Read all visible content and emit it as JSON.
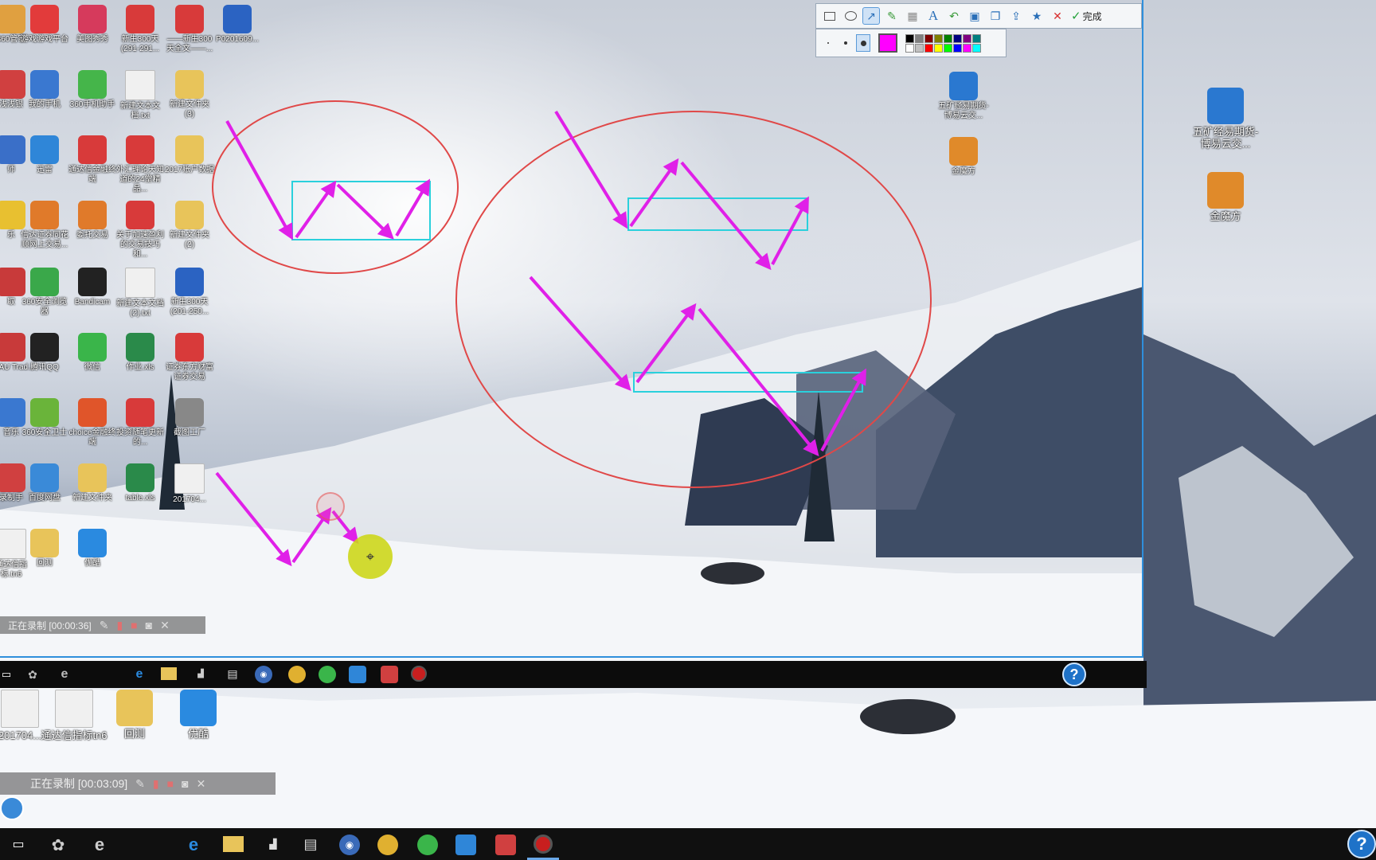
{
  "colors": {
    "annotation_arrow": "#e020e8",
    "annotation_rect": "#2ad0dc",
    "annotation_ellipse": "#e04848",
    "selection_border": "#2f8fdc",
    "current_color": "#ff00ff"
  },
  "desktop_icons": [
    {
      "label": "360管家",
      "icon": "app-icon",
      "color": "#e0a040"
    },
    {
      "label": "游戏游戏平台",
      "icon": "game-center-icon",
      "color": "#e23b3b"
    },
    {
      "label": "美图秀秀",
      "icon": "meitu-icon",
      "color": "#d63a5c"
    },
    {
      "label": "新生300天 (291-291...",
      "icon": "pdf-icon",
      "color": "#d83a3a"
    },
    {
      "label": "——新生300天全文——...",
      "icon": "pdf-icon",
      "color": "#d83a3a"
    },
    {
      "label": "P0201609...",
      "icon": "word-doc-icon",
      "color": "#2b63c2"
    },
    {
      "label": "浅浅银",
      "icon": "app-icon",
      "color": "#d04040"
    },
    {
      "label": "我的手机",
      "icon": "phone-icon",
      "color": "#3a78d0"
    },
    {
      "label": "360手机助手",
      "icon": "phone-assistant-icon",
      "color": "#45b54a"
    },
    {
      "label": "新建文本文档.txt",
      "icon": "text-file-icon",
      "color": "#f0f0f0"
    },
    {
      "label": "新建文件夹 (3)",
      "icon": "folder-icon",
      "color": "#e8c45a"
    },
    {
      "label": "师",
      "icon": "app-icon",
      "color": "#3a6fc8"
    },
    {
      "label": "迅雷",
      "icon": "thunder-icon",
      "color": "#2f86d8"
    },
    {
      "label": "通达信金融终端",
      "icon": "tdx-icon",
      "color": "#d83a3a"
    },
    {
      "label": "外汇理论天知道的24堂精品...",
      "icon": "pdf-icon",
      "color": "#d83a3a"
    },
    {
      "label": "2017账户数据",
      "icon": "folder-icon",
      "color": "#e8c45a"
    },
    {
      "label": "乐",
      "icon": "app-icon",
      "color": "#e8c030"
    },
    {
      "label": "信达证券同花顺网上交易...",
      "icon": "house-icon",
      "color": "#e07a2a"
    },
    {
      "label": "委托交易",
      "icon": "house-icon",
      "color": "#e07a2a"
    },
    {
      "label": "关于加速盈利的交易技巧和...",
      "icon": "pdf-icon",
      "color": "#d83a3a"
    },
    {
      "label": "新建文件夹 (2)",
      "icon": "folder-icon",
      "color": "#e8c45a"
    },
    {
      "label": "取",
      "icon": "app-icon",
      "color": "#c83a3a"
    },
    {
      "label": "360安全浏览器",
      "icon": "browser-360-icon",
      "color": "#3aa84a"
    },
    {
      "label": "Bandicam",
      "icon": "bandicam-icon",
      "color": "#222222"
    },
    {
      "label": "新建文本文档 (2).txt",
      "icon": "text-file-icon",
      "color": "#f0f0f0"
    },
    {
      "label": "新生300天 (201-250...",
      "icon": "word-doc-icon",
      "color": "#2b63c2"
    },
    {
      "label": "aA AU Trad...",
      "icon": "app-icon",
      "color": "#c83a3a"
    },
    {
      "label": "腾讯QQ",
      "icon": "qq-icon",
      "color": "#222222"
    },
    {
      "label": "微信",
      "icon": "wechat-icon",
      "color": "#3ab54a"
    },
    {
      "label": "作业.xls",
      "icon": "excel-icon",
      "color": "#2a8a4a"
    },
    {
      "label": "证券东方财富证券交易",
      "icon": "securities-icon",
      "color": "#d83a3a"
    },
    {
      "label": "音乐",
      "icon": "app-icon",
      "color": "#3a78d0"
    },
    {
      "label": "360安全卫士",
      "icon": "guard-360-icon",
      "color": "#6ab43a"
    },
    {
      "label": "choice金融终端",
      "icon": "choice-icon",
      "color": "#e0552a"
    },
    {
      "label": "投资随笔更新的...",
      "icon": "pdf-icon",
      "color": "#d83a3a"
    },
    {
      "label": "截图工厂",
      "icon": "camera-icon",
      "color": "#888888"
    },
    {
      "label": "录制手",
      "icon": "app-icon",
      "color": "#d04040"
    },
    {
      "label": "百度网盘",
      "icon": "baidu-cloud-icon",
      "color": "#3a8ad8"
    },
    {
      "label": "新建文件夹",
      "icon": "folder-icon",
      "color": "#e8c45a"
    },
    {
      "label": "table.xls",
      "icon": "excel-icon",
      "color": "#2a8a4a"
    },
    {
      "label": "201704...",
      "icon": "text-file-icon",
      "color": "#f0f0f0"
    },
    {
      "label": "通达信指标.tn6",
      "icon": "text-file-icon",
      "color": "#f0f0f0"
    },
    {
      "label": "回测",
      "icon": "folder-icon",
      "color": "#e8c45a"
    },
    {
      "label": "优酷",
      "icon": "youku-icon",
      "color": "#2a8ae0"
    }
  ],
  "right_icons_small": [
    {
      "label": "五矿经易期货-博易云交...",
      "icon": "wukuang-icon",
      "color": "#2a78d0"
    },
    {
      "label": "金魔方",
      "icon": "jinmofang-icon",
      "color": "#e08a2a"
    }
  ],
  "right_icons_big": [
    {
      "label": "五矿经易期货-博易云交...",
      "icon": "wukuang-icon",
      "color": "#2a78d0"
    },
    {
      "label": "金魔方",
      "icon": "jinmofang-icon",
      "color": "#e08a2a"
    }
  ],
  "bottom_icons_big": [
    {
      "label": "201704...",
      "icon": "text-file-icon",
      "color": "#f0f0f0"
    },
    {
      "label": "通达信指标tn6",
      "icon": "text-file-icon",
      "color": "#f0f0f0"
    },
    {
      "label": "回测",
      "icon": "folder-icon",
      "color": "#e8c45a"
    },
    {
      "label": "优酷",
      "icon": "youku-icon",
      "color": "#2a8ae0"
    }
  ],
  "toolbar": {
    "tools": [
      "rectangle-icon",
      "ellipse-icon",
      "arrow-icon",
      "brush-icon",
      "mosaic-icon",
      "text-icon",
      "undo-icon",
      "save-icon",
      "copy-icon",
      "share-icon",
      "pin-icon",
      "cancel-icon"
    ],
    "done_label": "完成",
    "palette": [
      "#000000",
      "#808080",
      "#800000",
      "#808000",
      "#008000",
      "#000080",
      "#800080",
      "#008080",
      "#ffffff",
      "#c0c0c0",
      "#ff0000",
      "#ffff00",
      "#00ff00",
      "#0000ff",
      "#ff00ff",
      "#00ffff"
    ]
  },
  "recorder_inner": {
    "text": "正在录制 [00:00:36]"
  },
  "recorder_outer": {
    "text": "正在录制 [00:03:09]"
  },
  "help_label": "?"
}
